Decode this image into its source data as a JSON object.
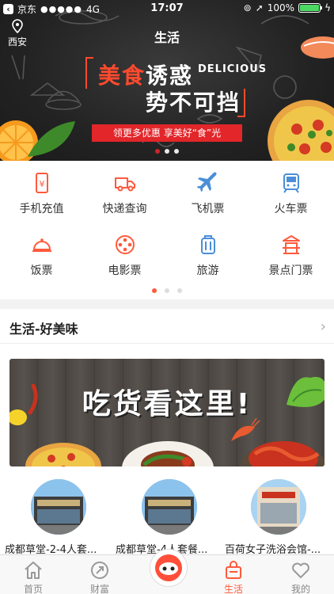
{
  "status_bar": {
    "back_app": "京东",
    "signal_dots": "●●●●●",
    "network": "4G",
    "time": "17:07",
    "battery_percent": "100%",
    "battery_level": 1.0
  },
  "header": {
    "location": "西安",
    "title": "生活"
  },
  "hero_banner": {
    "line1_highlight": "美食",
    "line1_rest": "诱惑",
    "line1_en": "DELICIOUS",
    "line2": "势不可挡",
    "promo": "领更多优惠  享美好“食”光",
    "page_count": 3,
    "active_page": 0
  },
  "services": [
    {
      "label": "手机充值",
      "icon": "phone-recharge-icon"
    },
    {
      "label": "快递查询",
      "icon": "delivery-truck-icon"
    },
    {
      "label": "飞机票",
      "icon": "airplane-icon"
    },
    {
      "label": "火车票",
      "icon": "train-icon"
    },
    {
      "label": "饭票",
      "icon": "food-cloche-icon"
    },
    {
      "label": "电影票",
      "icon": "film-reel-icon"
    },
    {
      "label": "旅游",
      "icon": "suitcase-icon"
    },
    {
      "label": "景点门票",
      "icon": "pavilion-icon"
    }
  ],
  "services_pager": {
    "page_count": 3,
    "active_page": 0
  },
  "life_section": {
    "title": "生活-好美味",
    "banner_slogan": "吃货看这里!",
    "cards": [
      {
        "label": "成都草堂-2-4人套..."
      },
      {
        "label": "成都草堂-4人套餐..."
      },
      {
        "label": "百荷女子洗浴会馆-..."
      }
    ]
  },
  "tab_bar": {
    "tabs": [
      {
        "label": "首页",
        "icon": "home-icon"
      },
      {
        "label": "财富",
        "icon": "wealth-icon"
      },
      {
        "label": "",
        "icon": "mascot-icon"
      },
      {
        "label": "生活",
        "icon": "shopping-bag-icon"
      },
      {
        "label": "我的",
        "icon": "heart-icon"
      }
    ],
    "active": "生活",
    "accent": "#ff5a3c"
  },
  "colors": {
    "accent_red": "#e2262a",
    "accent_orange": "#ff5a3c",
    "icon_blue": "#4a8fd8"
  }
}
